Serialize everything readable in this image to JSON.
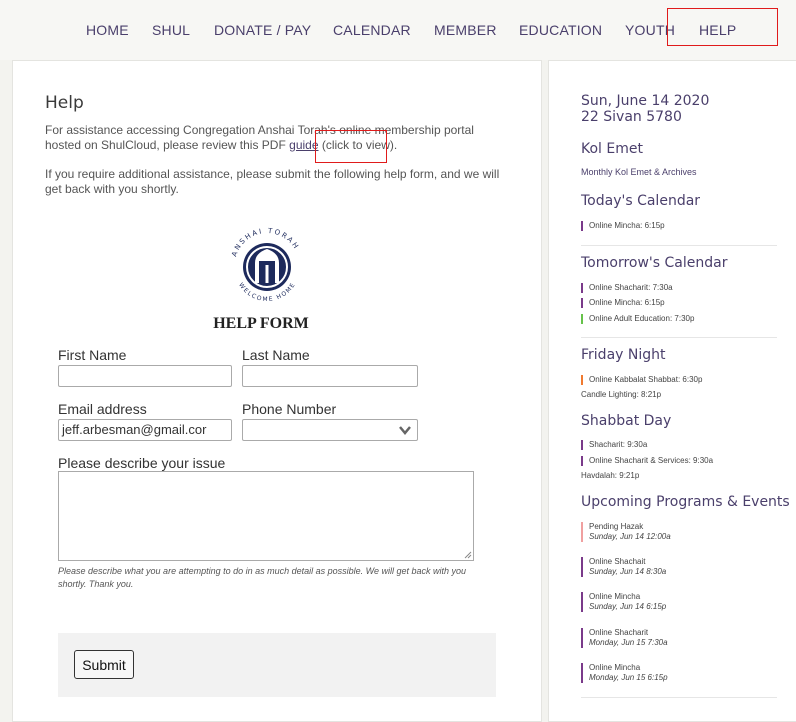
{
  "nav": {
    "items": [
      "HOME",
      "SHUL",
      "DONATE / PAY",
      "CALENDAR",
      "MEMBER",
      "EDUCATION",
      "YOUTH",
      "HELP"
    ]
  },
  "main": {
    "title": "Help",
    "p1_before": "For assistance accessing Congregation Anshai Torah's online membership portal hosted on ShulCloud, please review this PDF ",
    "p1_link": "guide",
    "p1_after": " (click to view).",
    "p2": "If you require additional assistance, please submit the following help form, and we will get back with you shortly.",
    "logo": {
      "top_text": "ANSHAI TORAH",
      "bottom_text": "WELCOME HOME",
      "icon": "torah-ark-logo"
    },
    "form_title": "HELP FORM",
    "first_name_label": "First Name",
    "last_name_label": "Last Name",
    "email_label": "Email address",
    "email_value": "jeff.arbesman@gmail.cor",
    "phone_label": "Phone Number",
    "issue_label": "Please describe your issue",
    "help_text": "Please describe what you are attempting to do in as much detail as possible.  We will get back with you shortly. Thank you.",
    "submit_label": "Submit"
  },
  "sidebar": {
    "date_line1": "Sun, June 14 2020",
    "date_line2": "22 Sivan 5780",
    "kol_emet_heading": "Kol Emet",
    "kol_emet_link": "Monthly Kol Emet & Archives",
    "today_heading": "Today's Calendar",
    "today_events": [
      "Online Mincha: 6:15p"
    ],
    "tomorrow_heading": "Tomorrow's Calendar",
    "tomorrow_events": [
      "Online Shacharit: 7:30a",
      "Online Mincha: 6:15p",
      "Online Adult Education: 7:30p"
    ],
    "friday_heading": "Friday Night",
    "friday_events": [
      "Online Kabbalat Shabbat: 6:30p",
      "Candle Lighting: 8:21p"
    ],
    "shabbat_heading": "Shabbat Day",
    "shabbat_events": [
      "Shacharit: 9:30a",
      "Online Shacharit & Services: 9:30a",
      "Havdalah: 9:21p"
    ],
    "upcoming_heading": "Upcoming Programs & Events",
    "upcoming": [
      {
        "name": "Pending Hazak",
        "when": "Sunday, Jun 14 12:00a"
      },
      {
        "name": "Online Shachait",
        "when": "Sunday, Jun 14 8:30a"
      },
      {
        "name": "Online Mincha",
        "when": "Sunday, Jun 14 6:15p"
      },
      {
        "name": "Online Shacharit",
        "when": "Monday, Jun 15 7:30a"
      },
      {
        "name": "Online Mincha",
        "when": "Monday, Jun 15 6:15p"
      }
    ]
  },
  "colors": {
    "nav_text": "#4a3f6b",
    "highlight_box": "#e01b1b",
    "event_purple": "#7a3a8a",
    "event_orange": "#f07a30",
    "event_green": "#66c24a",
    "event_pink": "#f0a0a0"
  }
}
